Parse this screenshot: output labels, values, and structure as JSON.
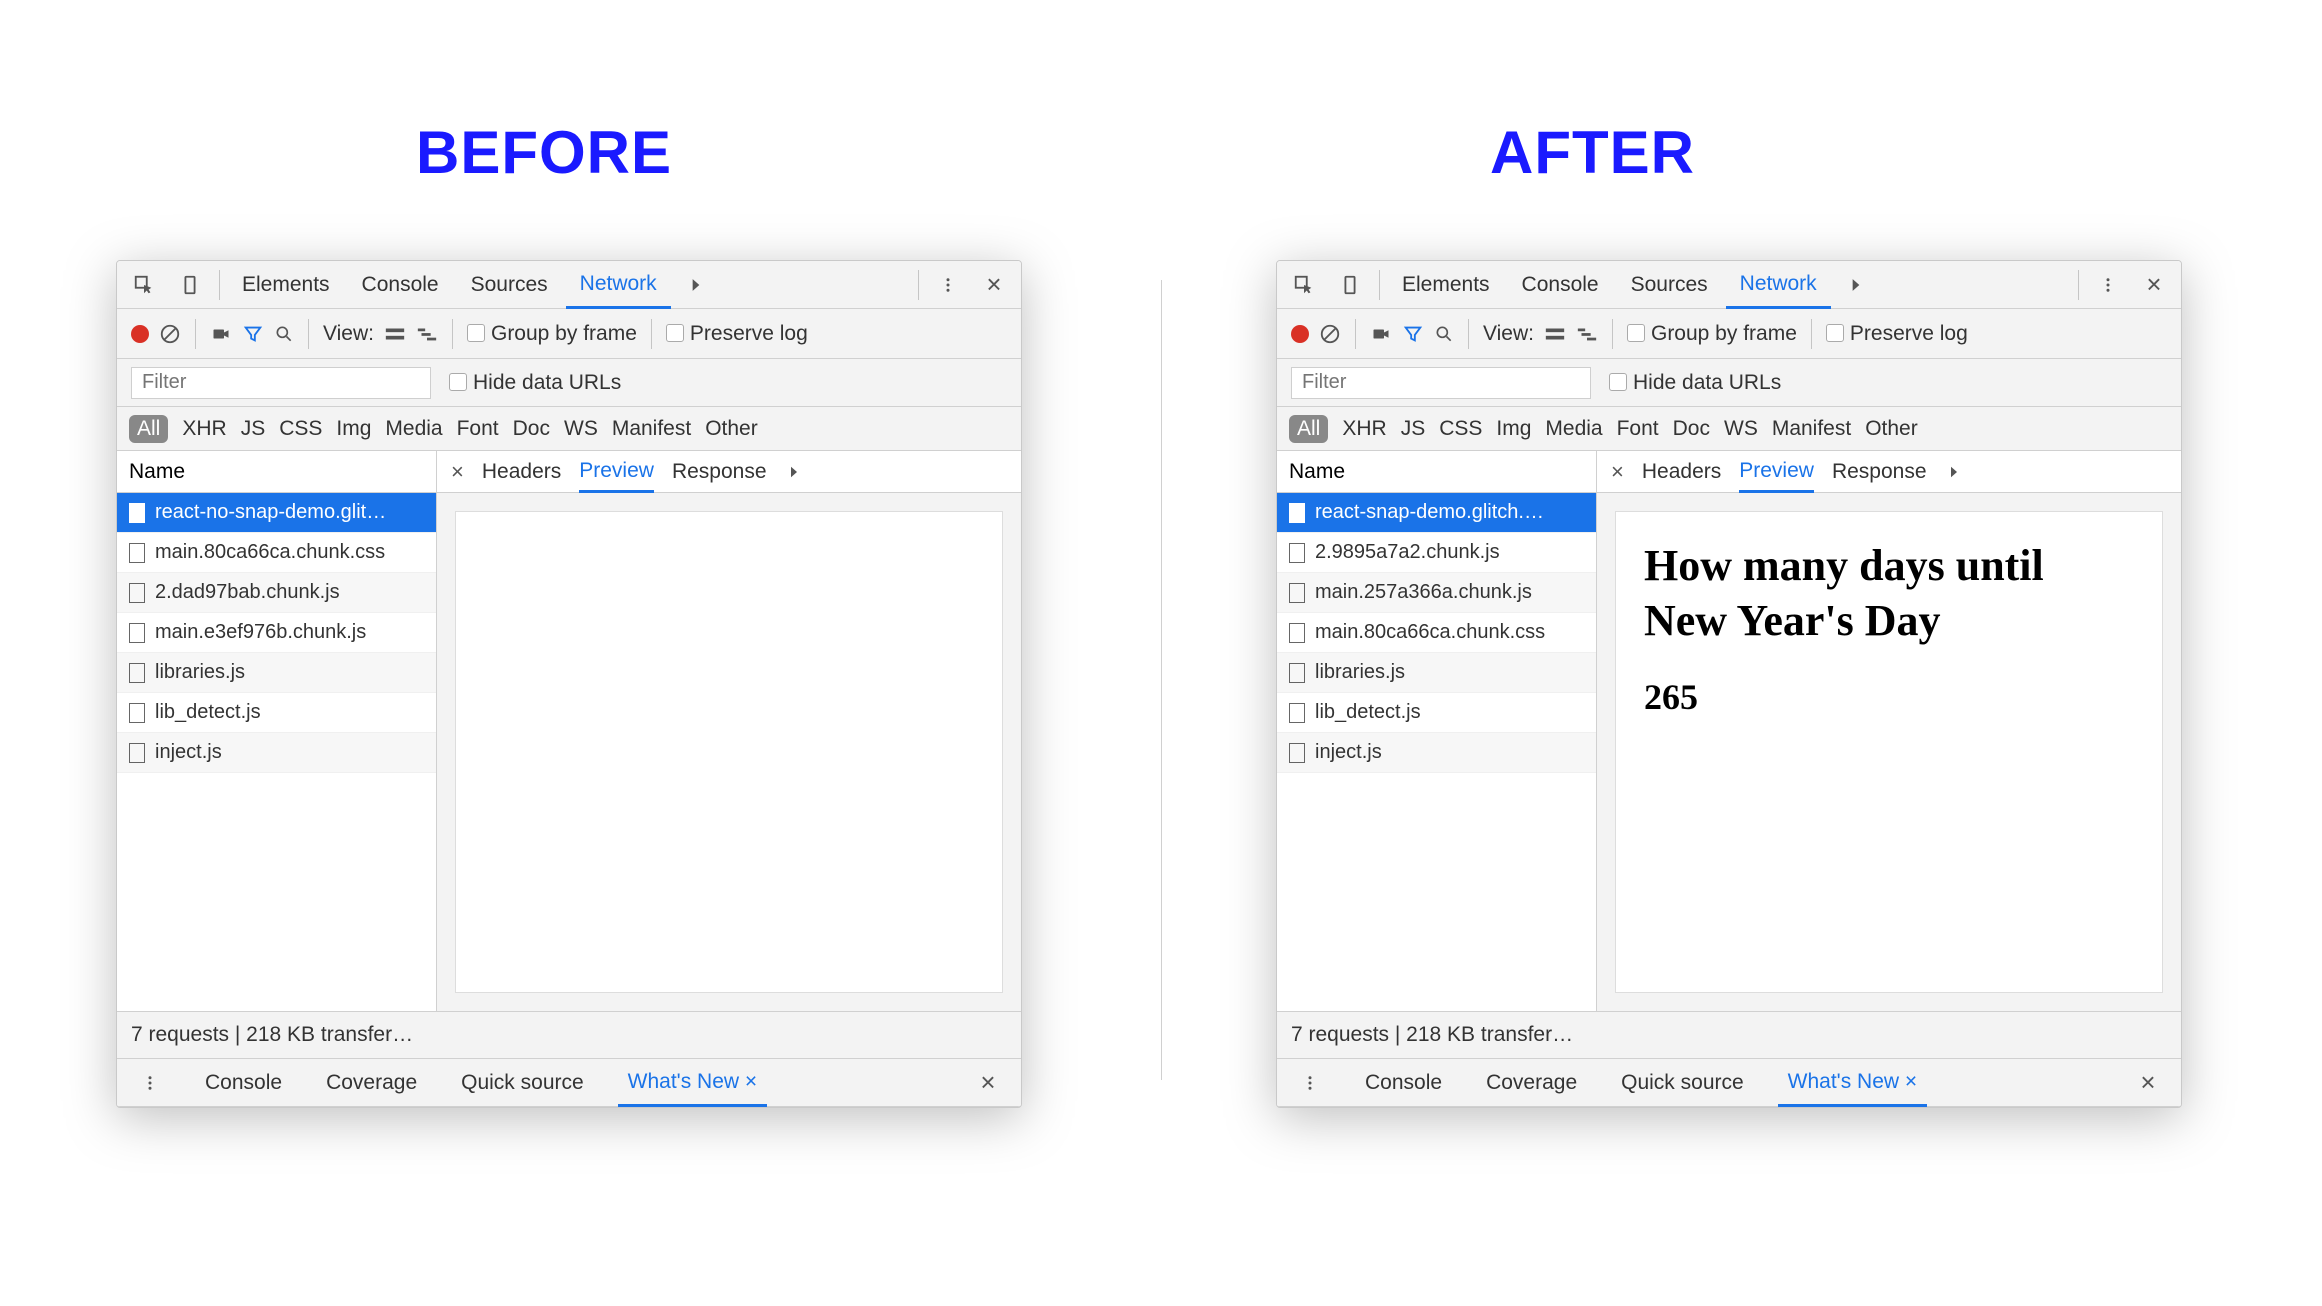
{
  "labels": {
    "before": "BEFORE",
    "after": "AFTER"
  },
  "top_tabs": {
    "elements": "Elements",
    "console": "Console",
    "sources": "Sources",
    "network": "Network"
  },
  "toolbar": {
    "view": "View:",
    "group_by_frame": "Group by frame",
    "preserve_log": "Preserve log"
  },
  "filter": {
    "placeholder": "Filter",
    "hide_data_urls": "Hide data URLs"
  },
  "categories": {
    "all": "All",
    "xhr": "XHR",
    "js": "JS",
    "css": "CSS",
    "img": "Img",
    "media": "Media",
    "font": "Font",
    "doc": "Doc",
    "ws": "WS",
    "manifest": "Manifest",
    "other": "Other"
  },
  "name_header": "Name",
  "detail_tabs": {
    "headers": "Headers",
    "preview": "Preview",
    "response": "Response"
  },
  "before_files": [
    {
      "name": "react-no-snap-demo.glit…",
      "selected": true
    },
    {
      "name": "main.80ca66ca.chunk.css"
    },
    {
      "name": "2.dad97bab.chunk.js"
    },
    {
      "name": "main.e3ef976b.chunk.js"
    },
    {
      "name": "libraries.js"
    },
    {
      "name": "lib_detect.js"
    },
    {
      "name": "inject.js"
    }
  ],
  "after_files": [
    {
      "name": "react-snap-demo.glitch.…",
      "selected": true
    },
    {
      "name": "2.9895a7a2.chunk.js"
    },
    {
      "name": "main.257a366a.chunk.js"
    },
    {
      "name": "main.80ca66ca.chunk.css"
    },
    {
      "name": "libraries.js"
    },
    {
      "name": "lib_detect.js"
    },
    {
      "name": "inject.js"
    }
  ],
  "after_preview": {
    "heading": "How many days until New Year's Day",
    "value": "265"
  },
  "status_bar": "7 requests | 218 KB transfer…",
  "drawer_tabs": {
    "console": "Console",
    "coverage": "Coverage",
    "quick_source": "Quick source",
    "whats_new": "What's New"
  },
  "close_glyph": "×"
}
